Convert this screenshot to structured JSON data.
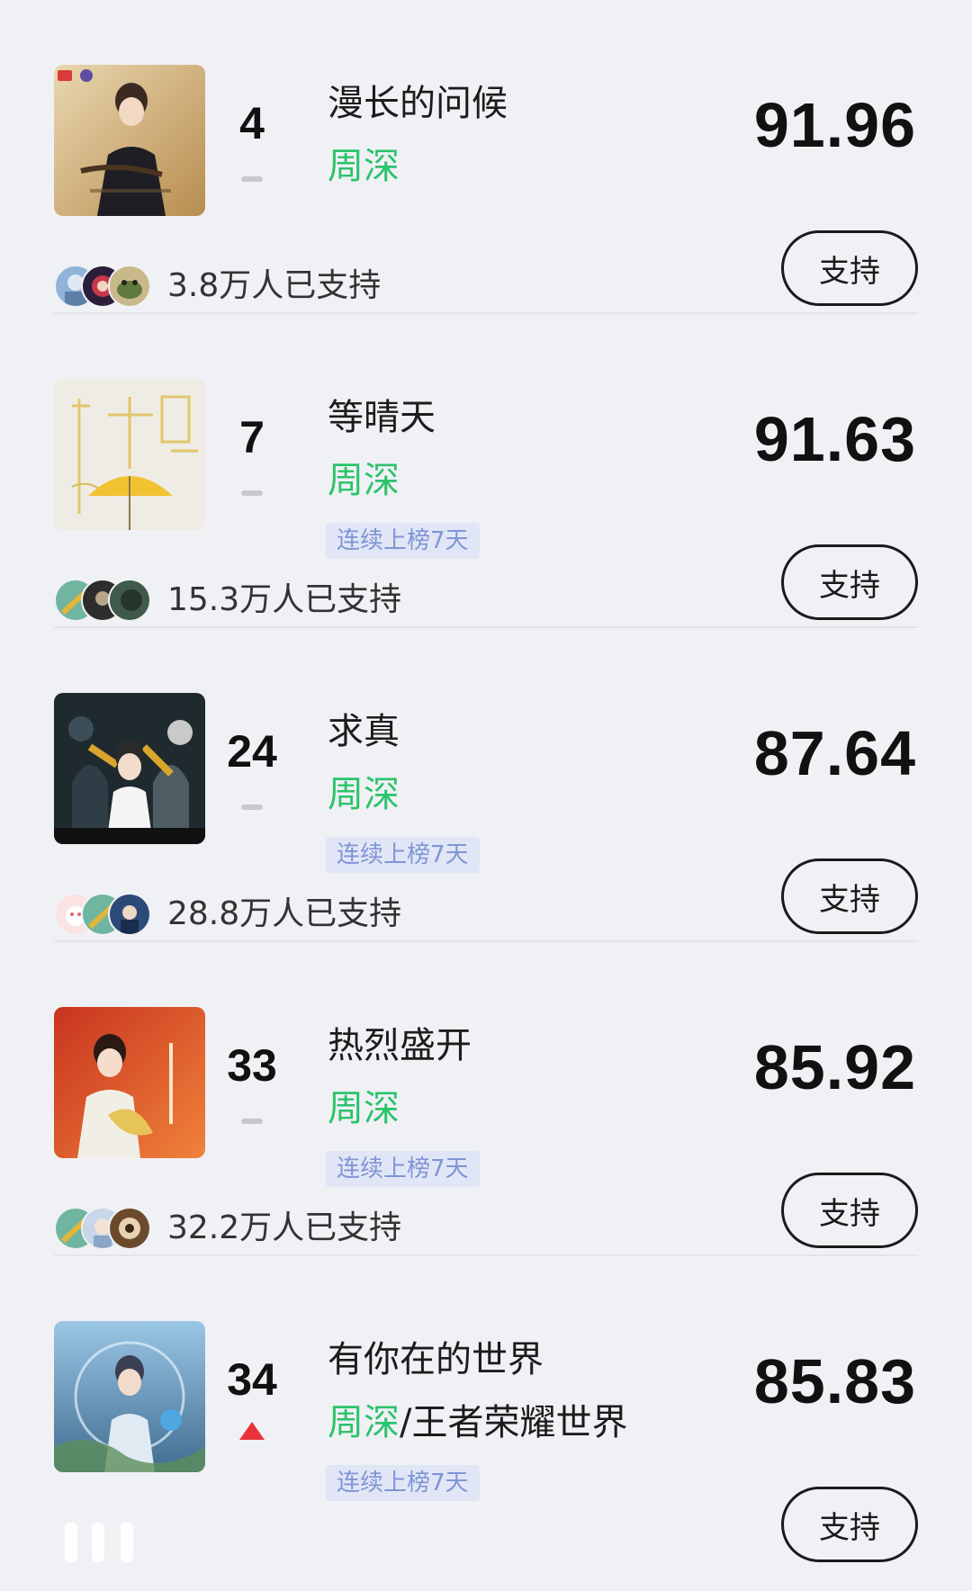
{
  "support_label": "支持",
  "streak_label": "连续上榜7天",
  "items": [
    {
      "rank": "4",
      "trend": "flat",
      "title": "漫长的问候",
      "artist_main": "周深",
      "artist_extra": "",
      "streak": false,
      "score": "91.96",
      "support_count": "3.8万人已支持"
    },
    {
      "rank": "7",
      "trend": "flat",
      "title": "等晴天",
      "artist_main": "周深",
      "artist_extra": "",
      "streak": true,
      "score": "91.63",
      "support_count": "15.3万人已支持"
    },
    {
      "rank": "24",
      "trend": "flat",
      "title": "求真",
      "artist_main": "周深",
      "artist_extra": "",
      "streak": true,
      "score": "87.64",
      "support_count": "28.8万人已支持"
    },
    {
      "rank": "33",
      "trend": "flat",
      "title": "热烈盛开",
      "artist_main": "周深",
      "artist_extra": "",
      "streak": true,
      "score": "85.92",
      "support_count": "32.2万人已支持"
    },
    {
      "rank": "34",
      "trend": "up",
      "title": "有你在的世界",
      "artist_main": "周深",
      "artist_extra": "/王者荣耀世界",
      "streak": true,
      "score": "85.83",
      "support_count": ""
    }
  ],
  "colors": {
    "background": "#f0f1f5",
    "artist_green": "#2cc36b",
    "streak_bg": "#e1e6f7",
    "streak_text": "#7f95d4",
    "trend_up": "#e8333d"
  }
}
